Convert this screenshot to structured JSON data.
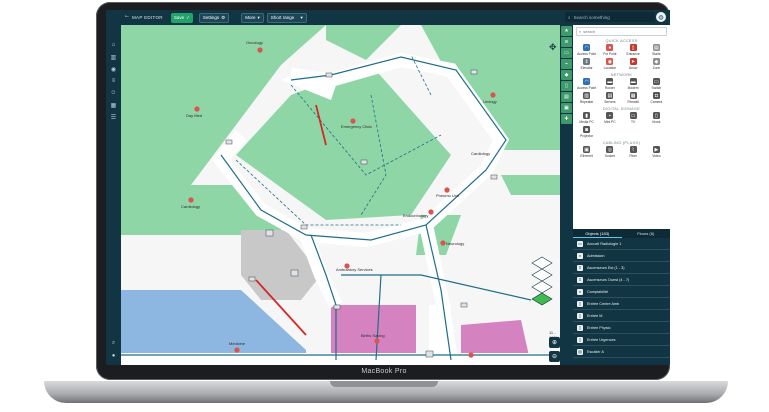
{
  "device": {
    "label": "MacBook Pro"
  },
  "topbar": {
    "title": "MAP EDITOR",
    "save_label": "Save",
    "settings_label": "Settings",
    "more_label": "More",
    "range_label": "Short range",
    "search_placeholder": "Search something"
  },
  "palette": {
    "search_placeholder": "search",
    "sections": [
      {
        "title": "QUICK ACCESS",
        "items": [
          {
            "label": "Access Point",
            "icon": "wifi-icon",
            "color": "#2f6fb5"
          },
          {
            "label": "Poi Point",
            "icon": "pin-icon",
            "color": "#d9534f"
          },
          {
            "label": "Entrance",
            "icon": "door-icon",
            "color": "#c0392b"
          },
          {
            "label": "Stairs",
            "icon": "stairs-icon",
            "color": "#8a8f93"
          },
          {
            "label": "Elevator",
            "icon": "elevator-icon",
            "color": "#6c7a80"
          },
          {
            "label": "Location",
            "icon": "location-icon",
            "color": "#d9534f"
          },
          {
            "label": "Arrow",
            "icon": "arrow-icon",
            "color": "#c0392b"
          },
          {
            "label": "Zone",
            "icon": "zone-icon",
            "color": "#8a8f93"
          }
        ]
      },
      {
        "title": "NETWORK",
        "items": [
          {
            "label": "Access Point",
            "icon": "wifi-icon",
            "color": "#2f6fb5"
          },
          {
            "label": "Router",
            "icon": "router-icon",
            "color": "#555"
          },
          {
            "label": "Modem",
            "icon": "modem-icon",
            "color": "#555"
          },
          {
            "label": "Switch",
            "icon": "switch-icon",
            "color": "#555"
          },
          {
            "label": "Repeater",
            "icon": "repeater-icon",
            "color": "#555"
          },
          {
            "label": "Servers",
            "icon": "server-icon",
            "color": "#555"
          },
          {
            "label": "Firewall",
            "icon": "firewall-icon",
            "color": "#555"
          },
          {
            "label": "Camera",
            "icon": "camera-icon",
            "color": "#555"
          }
        ]
      },
      {
        "title": "DIGITAL SIGNAGE",
        "items": [
          {
            "label": "Media PC",
            "icon": "mediapc-icon",
            "color": "#555"
          },
          {
            "label": "Mini PC",
            "icon": "minipc-icon",
            "color": "#555"
          },
          {
            "label": "TV",
            "icon": "tv-icon",
            "color": "#555"
          },
          {
            "label": "Kiosk",
            "icon": "kiosk-icon",
            "color": "#555"
          },
          {
            "label": "Projector",
            "icon": "projector-icon",
            "color": "#555"
          }
        ]
      },
      {
        "title": "CABLING (PLUGS)",
        "items": [
          {
            "label": "Ethernet",
            "icon": "ethernet-icon",
            "color": "#555"
          },
          {
            "label": "Socket",
            "icon": "socket-icon",
            "color": "#555"
          },
          {
            "label": "Fiber",
            "icon": "fiber-icon",
            "color": "#555"
          },
          {
            "label": "Video",
            "icon": "video-icon",
            "color": "#555"
          }
        ]
      }
    ]
  },
  "objects": {
    "tabs": [
      {
        "label": "Objects (183)"
      },
      {
        "label": "Floors (6)"
      }
    ],
    "rows": [
      "Accueil Radiologie 1",
      "Admission",
      "Ascenseurs Est (1 - 3)",
      "Ascenseurs Ouest (4 - 7)",
      "Comptabilité",
      "Entrée Centre Amb",
      "Entrée M",
      "Entrée Physio",
      "Entrée Urgences",
      "Escalier A"
    ]
  },
  "map": {
    "zoom_readout": "11 - 100%",
    "labels": [
      "Oncology",
      "Day Med",
      "Emergency Clinic",
      "Urology",
      "Cardiology",
      "Endocrinology",
      "Pneumo Unit",
      "Neurology",
      "Ambulatory Services",
      "Radiology",
      "Births Saving",
      "Medicine"
    ],
    "colors": {
      "green_zone": "#8fd6a6",
      "corridor": "#ffffff",
      "path": "#1f6e8a",
      "pink_zone": "#d483c0",
      "blue_zone": "#8db6e0",
      "gray_zone": "#c8c8c8"
    }
  },
  "icons": {
    "back": "←",
    "check": "✓",
    "chevron": "▾",
    "search": "⌕",
    "globe": "◍",
    "zoom_in": "⊕",
    "zoom_out": "⊖",
    "move": "✥"
  }
}
